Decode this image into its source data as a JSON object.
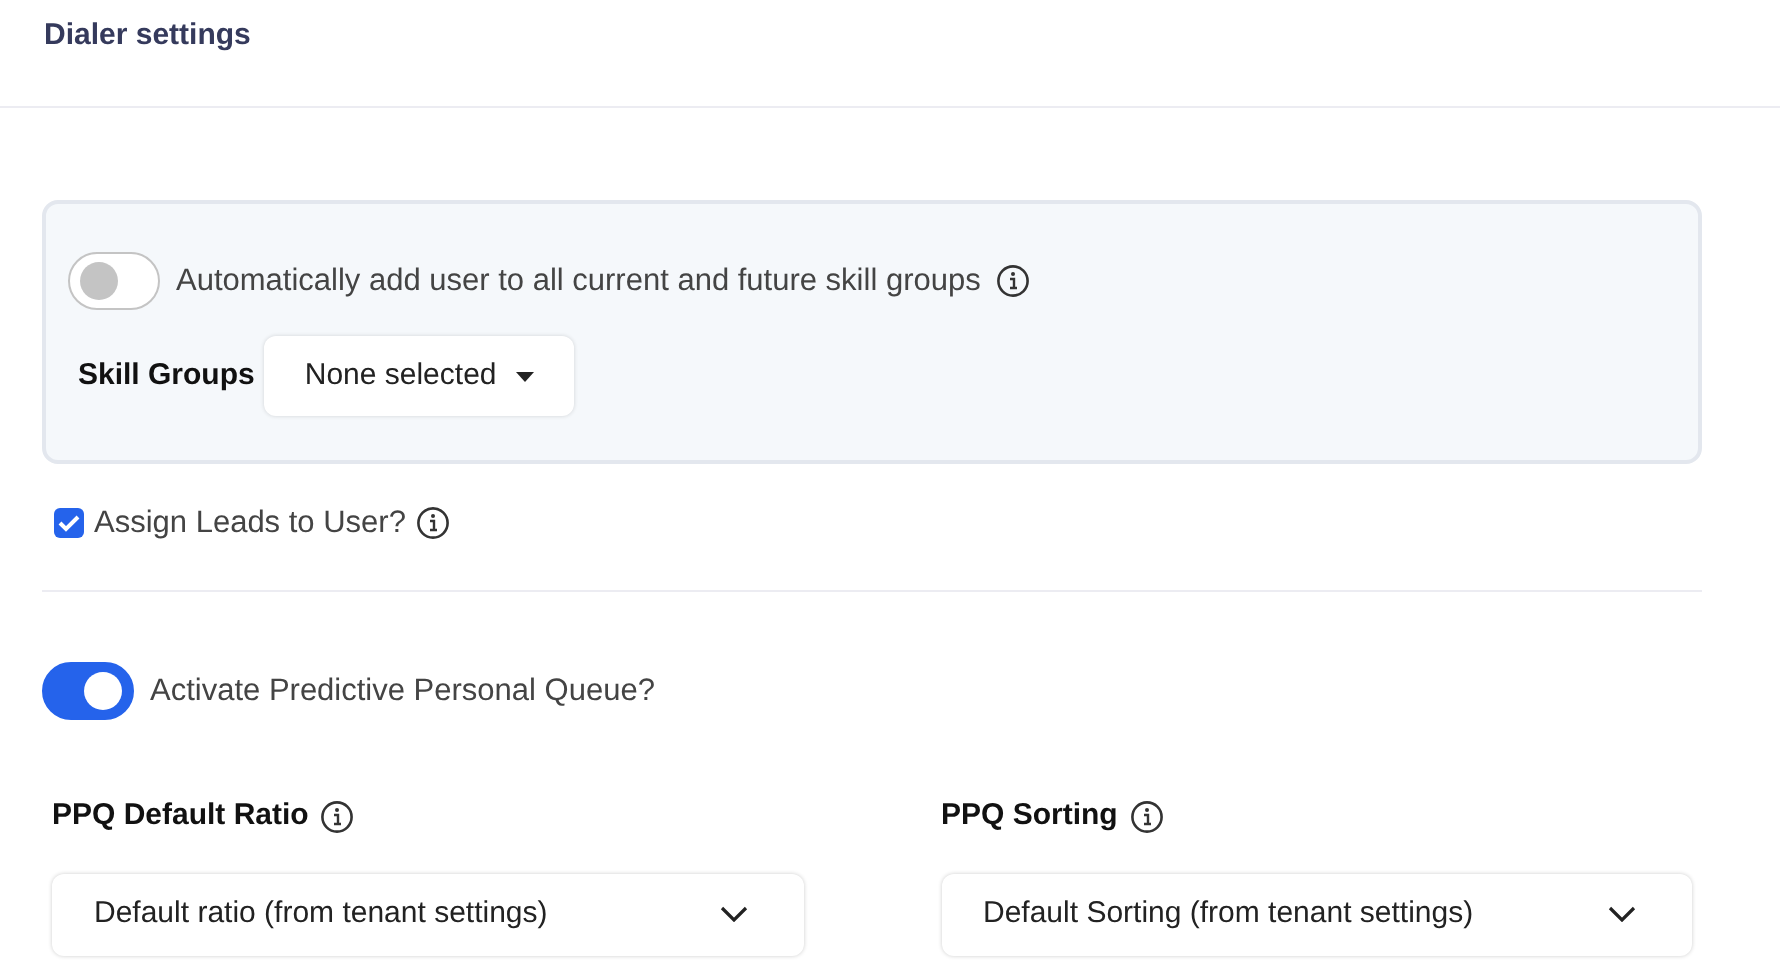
{
  "title": "Dialer settings",
  "skill_panel": {
    "auto_add": {
      "label": "Automatically add user to all current and future skill groups",
      "on": false
    },
    "skill_groups": {
      "label": "Skill Groups",
      "value": "None selected"
    }
  },
  "assign_leads": {
    "label": "Assign Leads to User?",
    "checked": true
  },
  "ppq": {
    "label": "Activate Predictive Personal Queue?",
    "on": true
  },
  "selects": [
    {
      "label": "PPQ Default Ratio",
      "value": "Default ratio (from tenant settings)"
    },
    {
      "label": "PPQ Sorting",
      "value": "Default Sorting (from tenant settings)"
    }
  ]
}
